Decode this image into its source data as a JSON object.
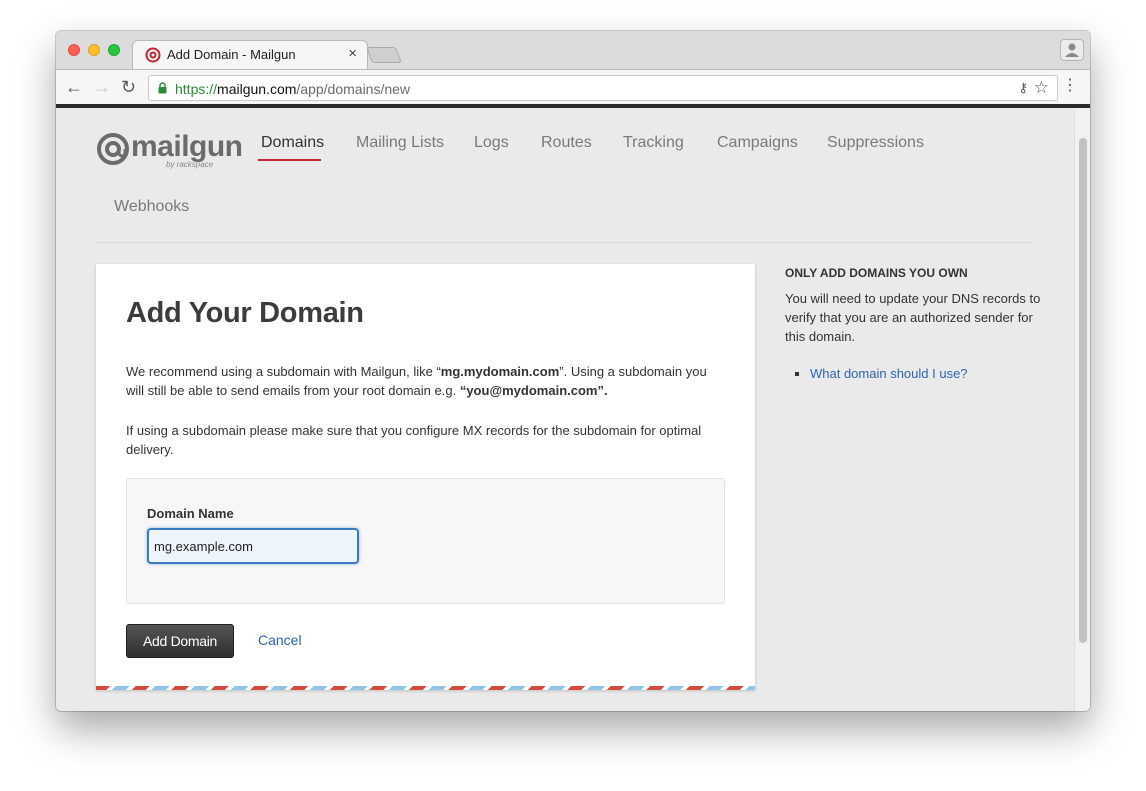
{
  "browser": {
    "tab_title": "Add Domain - Mailgun",
    "tab_close": "×",
    "url_scheme": "https://",
    "url_host": "mailgun.com",
    "url_path": "/app/domains/new"
  },
  "header": {
    "logo_text": "@mailgun",
    "logo_sub": "by rackspace",
    "nav": [
      "Domains",
      "Mailing Lists",
      "Logs",
      "Routes",
      "Tracking",
      "Campaigns",
      "Suppressions",
      "Webhooks"
    ],
    "active_nav": "Domains"
  },
  "card": {
    "title": "Add Your Domain",
    "intro_before": "We recommend using a subdomain with Mailgun, like “",
    "intro_bold1": "mg.mydomain.com",
    "intro_middle": "”. Using a subdomain you will still be able to send emails from your root domain e.g. ",
    "intro_bold2": "“you@mydomain.com”.",
    "note": "If using a subdomain please make sure that you configure MX records for the subdomain for optimal delivery.",
    "field_label": "Domain Name",
    "field_value": "mg.example.com",
    "submit_label": "Add Domain",
    "cancel_label": "Cancel"
  },
  "sidebar": {
    "title": "ONLY ADD DOMAINS YOU OWN",
    "text": "You will need to update your DNS records to verify that you are an authorized sender for this domain.",
    "link": "What domain should I use?"
  },
  "colors": {
    "accent_red": "#c0262d",
    "link_blue": "#2e64b0",
    "input_border": "#3b78c4"
  }
}
